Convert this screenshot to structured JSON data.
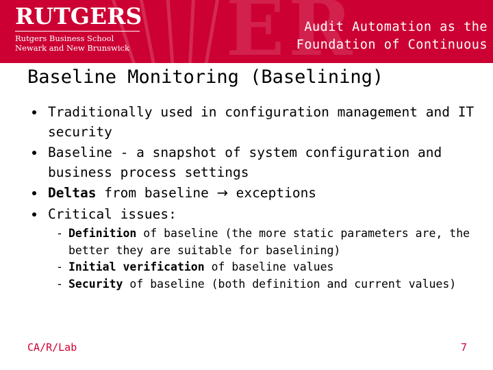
{
  "header": {
    "logo": {
      "title": "RUTGERS",
      "sub1": "Rutgers Business School",
      "sub2": "Newark and New Brunswick",
      "ghost_letter": "ER"
    },
    "deck_title_line1": "Audit Automation as the",
    "deck_title_line2": "Foundation of Continuous"
  },
  "slide": {
    "title": "Baseline Monitoring (Baselining)",
    "bullets": [
      {
        "level": 1,
        "segments": [
          {
            "text": "Traditionally used in configuration management and IT security",
            "bold": false
          }
        ]
      },
      {
        "level": 1,
        "segments": [
          {
            "text": "Baseline - a snapshot of system configuration and business process settings",
            "bold": false
          }
        ]
      },
      {
        "level": 1,
        "segments": [
          {
            "text": "Deltas",
            "bold": true
          },
          {
            "text": " from baseline ",
            "bold": false
          },
          {
            "text": "→",
            "bold": false
          },
          {
            "text": " exceptions",
            "bold": false
          }
        ]
      },
      {
        "level": 1,
        "segments": [
          {
            "text": "Critical issues:",
            "bold": false
          }
        ]
      },
      {
        "level": 2,
        "dash": "-",
        "segments": [
          {
            "text": "Definition",
            "bold": true
          },
          {
            "text": " of baseline (the more static parameters are, the better they are suitable for baselining)",
            "bold": false
          }
        ]
      },
      {
        "level": 2,
        "dash": "-",
        "segments": [
          {
            "text": "Initial verification",
            "bold": true
          },
          {
            "text": " of baseline values",
            "bold": false
          }
        ]
      },
      {
        "level": 2,
        "dash": "-",
        "segments": [
          {
            "text": "Security",
            "bold": true
          },
          {
            "text": " of baseline (both definition and current values)",
            "bold": false
          }
        ]
      }
    ]
  },
  "footer": {
    "left": "CA/R/Lab",
    "page": "7"
  },
  "colors": {
    "brand_red": "#cc0033",
    "text": "#000000",
    "background": "#ffffff"
  }
}
